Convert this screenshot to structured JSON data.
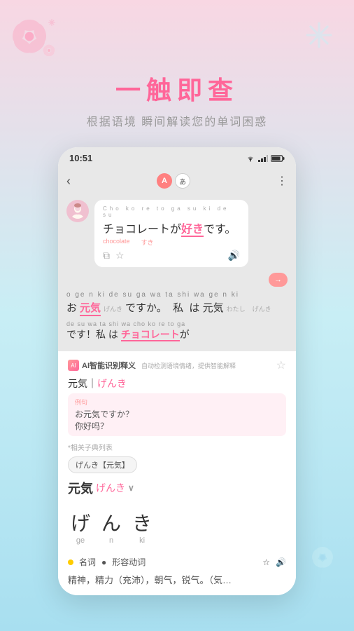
{
  "app": {
    "header": {
      "main_title": "一触即查",
      "sub_title": "根据语境  瞬间解读您的单词困惑"
    },
    "status_bar": {
      "time": "10:51",
      "wifi_icon": "wifi",
      "signal_icon": "signal",
      "battery_icon": "battery"
    },
    "app_header": {
      "back_label": "‹",
      "lang_a": "A",
      "lang_jp": "あ",
      "dots": "⋮"
    },
    "chat": {
      "furigana": "Cho ko re to ga su ki de su",
      "bubble_text": "チョコレートが好きです。",
      "ruby_chocolate": "chocolate",
      "ruby_suki": "すき",
      "chat_bubble_right": "→",
      "line2_furigana": "o ge n ki de su ga   wa ta shi  wa ge n ki",
      "line2_jp": "お元気ですか。  私  は 元気",
      "line2_ruby1": "げんき",
      "line2_ruby2": "わたし",
      "line2_ruby3": "げんき",
      "line3_furigana": "de su  wa ta shi  wa cho ko re  to ga",
      "line3_jp": "です！私 は チョコレートが"
    },
    "dict": {
      "ai_label": "AI智能识别释义",
      "ai_badge": "自动检测语境情绪，提供智能解释",
      "word_entry": "元気｜げんき",
      "example_label": "例句",
      "example_text": "お元気ですか？",
      "example_translation": "你好吗？",
      "related_label": "*相关子典列表",
      "related_tag": "げんき【元気】",
      "main_word": "元気",
      "main_ruby": "げんき",
      "kana": [
        {
          "char": "げ",
          "roma": "ge"
        },
        {
          "char": "ん",
          "roma": "n"
        },
        {
          "char": "き",
          "roma": "ki"
        }
      ],
      "pos1": "名词",
      "pos2": "形容动词",
      "meaning": "精神，精力（充沛），朝气，锐气。（気…"
    }
  }
}
